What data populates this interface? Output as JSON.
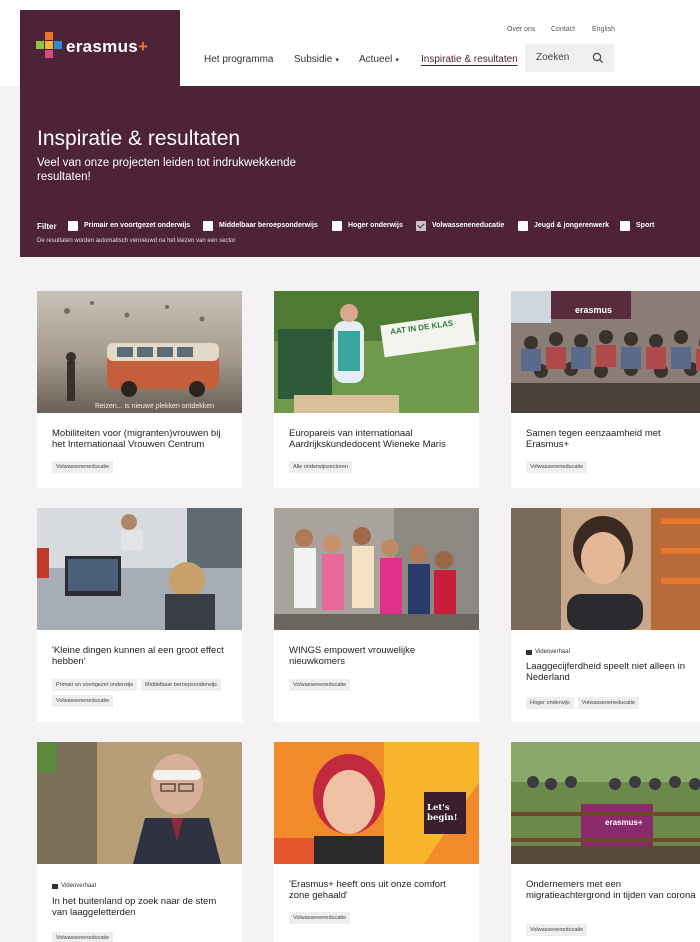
{
  "brand": {
    "name": "erasmus",
    "plus": "+"
  },
  "utility_nav": [
    "Over ons",
    "Contact",
    "English"
  ],
  "main_nav": [
    {
      "label": "Het programma",
      "dropdown": false,
      "active": false
    },
    {
      "label": "Subsidie",
      "dropdown": true,
      "active": false
    },
    {
      "label": "Actueel",
      "dropdown": true,
      "active": false
    },
    {
      "label": "Inspiratie & resultaten",
      "dropdown": false,
      "active": true
    }
  ],
  "search": {
    "label": "Zoeken",
    "icon": "search-icon"
  },
  "hero": {
    "title": "Inspiratie & resultaten",
    "subtitle": "Veel van onze projecten leiden tot indrukwekkende resultaten!"
  },
  "filter": {
    "label": "Filter",
    "options": [
      {
        "label": "Primair en voortgezet onderwijs",
        "checked": false
      },
      {
        "label": "Middelbaar beroepsonderwijs",
        "checked": false
      },
      {
        "label": "Hoger onderwijs",
        "checked": false
      },
      {
        "label": "Volwasseneneducatie",
        "checked": true
      },
      {
        "label": "Jeugd & jongerenwerk",
        "checked": false
      },
      {
        "label": "Sport",
        "checked": false
      }
    ],
    "note": "De resultaten worden automatisch vernieuwd na het kiezen van een sector"
  },
  "cards": [
    {
      "title": "Mobiliteiten voor (migranten)vrouwen bij het Internationaal Vrouwen Centrum",
      "type": "",
      "tags": [
        "Volwasseneneducatie"
      ],
      "image_caption": "Reizen... is nieuwe plekken ontdekken"
    },
    {
      "title": "Europareis van internationaal Aardrijkskundedocent Wieneke Maris",
      "type": "",
      "tags": [
        "Alle onderwijssectoren"
      ],
      "image_caption": "AAT IN DE KLAS"
    },
    {
      "title": "Samen tegen eenzaamheid met Erasmus+",
      "type": "",
      "tags": [
        "Volwasseneneducatie"
      ],
      "image_caption": "erasmus"
    },
    {
      "title": "'Kleine dingen kunnen al een groot effect hebben'",
      "type": "",
      "tags": [
        "Primair en voortgezet onderwijs",
        "Middelbaar beroepsonderwijs",
        "Volwasseneneducatie"
      ],
      "image_caption": ""
    },
    {
      "title": "WINGS empowert vrouwelijke nieuwkomers",
      "type": "",
      "tags": [
        "Volwasseneneducatie"
      ],
      "image_caption": ""
    },
    {
      "title": "Laaggecijferdheid speelt niet alleen in Nederland",
      "type": "Videoverhaal",
      "tags": [
        "Hoger onderwijs",
        "Volwasseneneducatie"
      ],
      "image_caption": ""
    },
    {
      "title": "In het buitenland op zoek naar de stem van laaggeletterden",
      "type": "Videoverhaal",
      "tags": [
        "Volwasseneneducatie"
      ],
      "image_caption": ""
    },
    {
      "title": "'Erasmus+ heeft ons uit onze comfort zone gehaald'",
      "type": "",
      "tags": [
        "Volwasseneneducatie"
      ],
      "image_caption": "Let's begin!"
    },
    {
      "title": "Ondernemers met een migratieachtergrond in tijden van corona",
      "type": "",
      "tags": [
        "Volwasseneneducatie"
      ],
      "image_caption": "erasmus+"
    }
  ],
  "colors": {
    "brand_purple": "#4e2237",
    "accent_orange": "#e9762b",
    "accent_green": "#8cc63f",
    "accent_blue": "#2d8dd0"
  }
}
